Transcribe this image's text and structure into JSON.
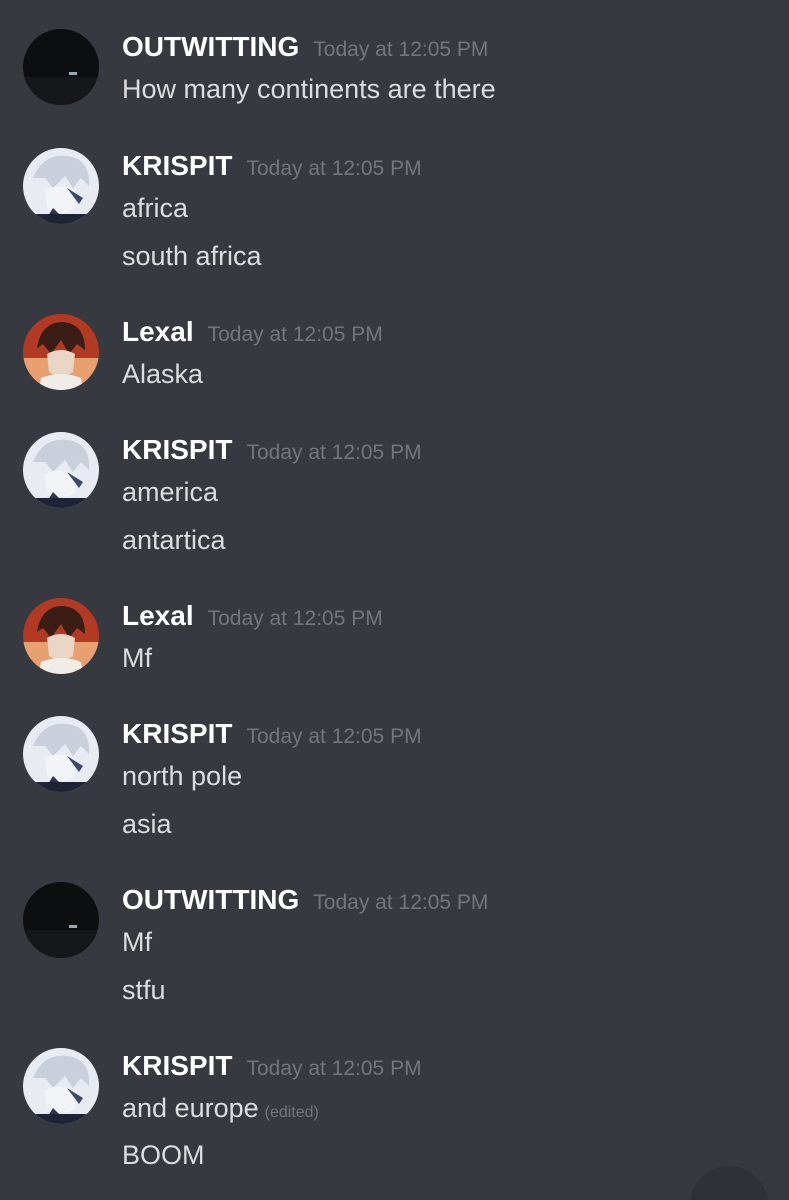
{
  "messages": [
    {
      "username": "OUTWITTING",
      "timestamp": "Today at 12:05 PM",
      "avatar": "night-scene-avatar",
      "lines": [
        "How many continents are there"
      ]
    },
    {
      "username": "KRISPIT",
      "timestamp": "Today at 12:05 PM",
      "avatar": "white-hair-anime-avatar",
      "lines": [
        "africa",
        "south africa"
      ]
    },
    {
      "username": "Lexal",
      "timestamp": "Today at 12:05 PM",
      "avatar": "brown-hair-anime-avatar",
      "lines": [
        "Alaska"
      ]
    },
    {
      "username": "KRISPIT",
      "timestamp": "Today at 12:05 PM",
      "avatar": "white-hair-anime-avatar",
      "lines": [
        "america",
        "antartica"
      ]
    },
    {
      "username": "Lexal",
      "timestamp": "Today at 12:05 PM",
      "avatar": "brown-hair-anime-avatar",
      "lines": [
        "Mf"
      ]
    },
    {
      "username": "KRISPIT",
      "timestamp": "Today at 12:05 PM",
      "avatar": "white-hair-anime-avatar",
      "lines": [
        "north pole",
        "asia"
      ]
    },
    {
      "username": "OUTWITTING",
      "timestamp": "Today at 12:05 PM",
      "avatar": "night-scene-avatar",
      "lines": [
        "Mf",
        "stfu"
      ]
    },
    {
      "username": "KRISPIT",
      "timestamp": "Today at 12:05 PM",
      "avatar": "white-hair-anime-avatar",
      "lines": [
        "and europe",
        "BOOM"
      ],
      "edited_label": "(edited)"
    }
  ],
  "jump_button_icon": "chevron-down-icon",
  "colors": {
    "background": "#36393f",
    "username": "#ffffff",
    "timestamp": "#72767d",
    "message_text": "#dcddde"
  }
}
